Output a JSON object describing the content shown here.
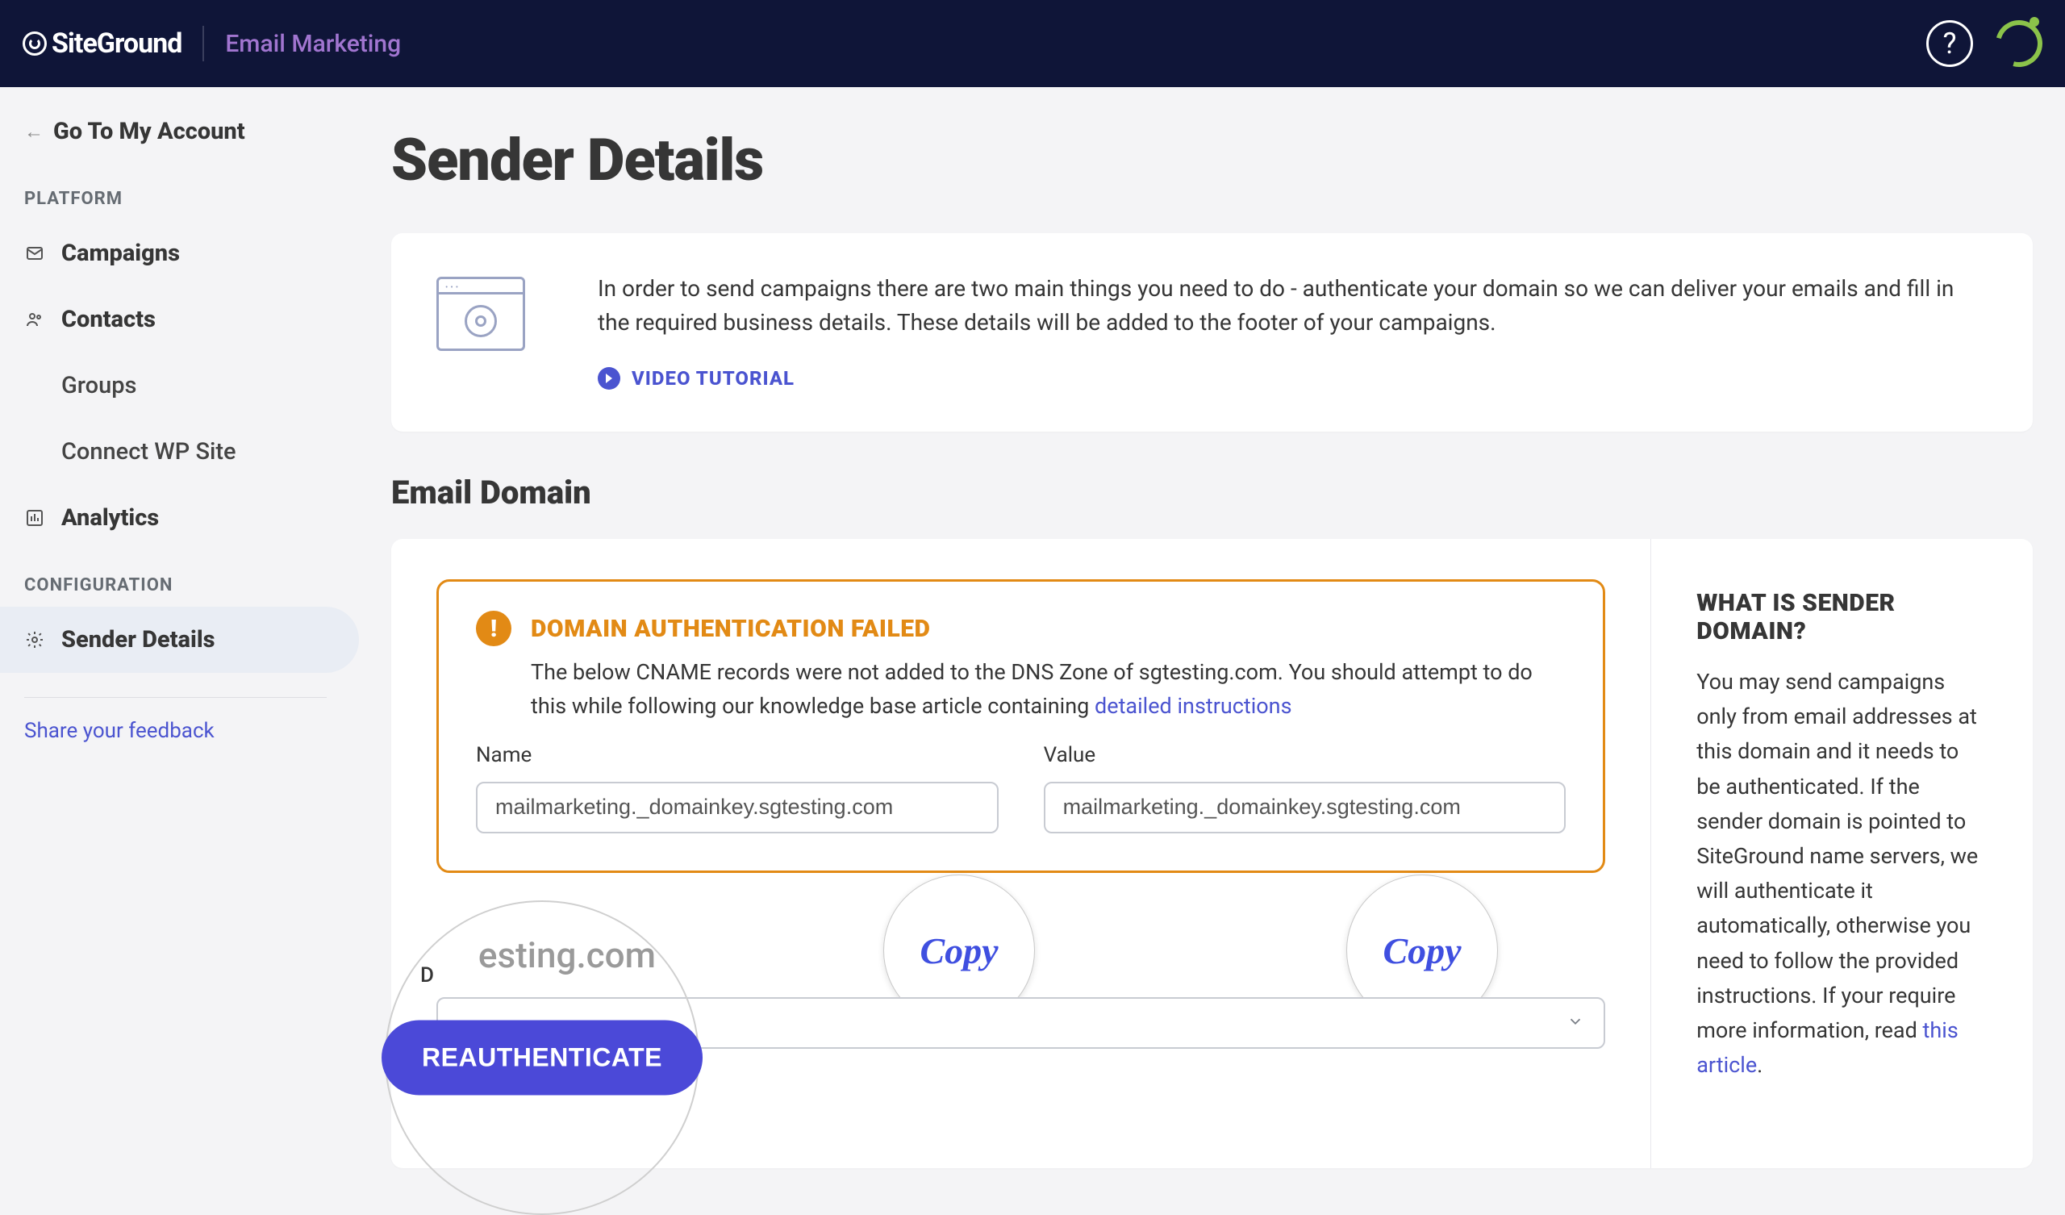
{
  "header": {
    "brand": "SiteGround",
    "app_name": "Email Marketing"
  },
  "sidebar": {
    "go_account": "Go To My Account",
    "section_platform": "PLATFORM",
    "section_configuration": "CONFIGURATION",
    "items": {
      "campaigns": "Campaigns",
      "contacts": "Contacts",
      "groups": "Groups",
      "connect_wp": "Connect WP Site",
      "analytics": "Analytics",
      "sender_details": "Sender Details"
    },
    "feedback": "Share your feedback"
  },
  "page": {
    "title": "Sender Details",
    "info_text": "In order to send campaigns there are two main things you need to do - authenticate your domain so we can deliver your emails and fill in the required business details. These details will be added to the footer of your campaigns.",
    "video_tutorial": "VIDEO TUTORIAL",
    "email_domain_heading": "Email Domain"
  },
  "alert": {
    "title": "DOMAIN AUTHENTICATION FAILED",
    "desc_prefix": "The below CNAME records were not added to the DNS Zone of sgtesting.com. You should attempt to do this while following our knowledge base article containing ",
    "desc_link": "detailed instructions",
    "name_label": "Name",
    "value_label": "Value",
    "name_value": "mailmarketing._domainkey.sgtesting.com",
    "value_value": "mailmarketing._domainkey.sgtesting.com",
    "copy_label": "Copy"
  },
  "domain_select": {
    "partial_text": "esting.com",
    "letter_d": "D"
  },
  "reauthenticate": "REAUTHENTICATE",
  "explain": {
    "title": "WHAT IS SENDER DOMAIN?",
    "text_prefix": "You may send campaigns only from email addresses at this domain and it needs to be authenticated. If the sender domain is pointed to SiteGround name servers, we will authenticate it automatically, otherwise you need to follow the provided instructions. If your require more information, read ",
    "link": "this article",
    "suffix": "."
  }
}
